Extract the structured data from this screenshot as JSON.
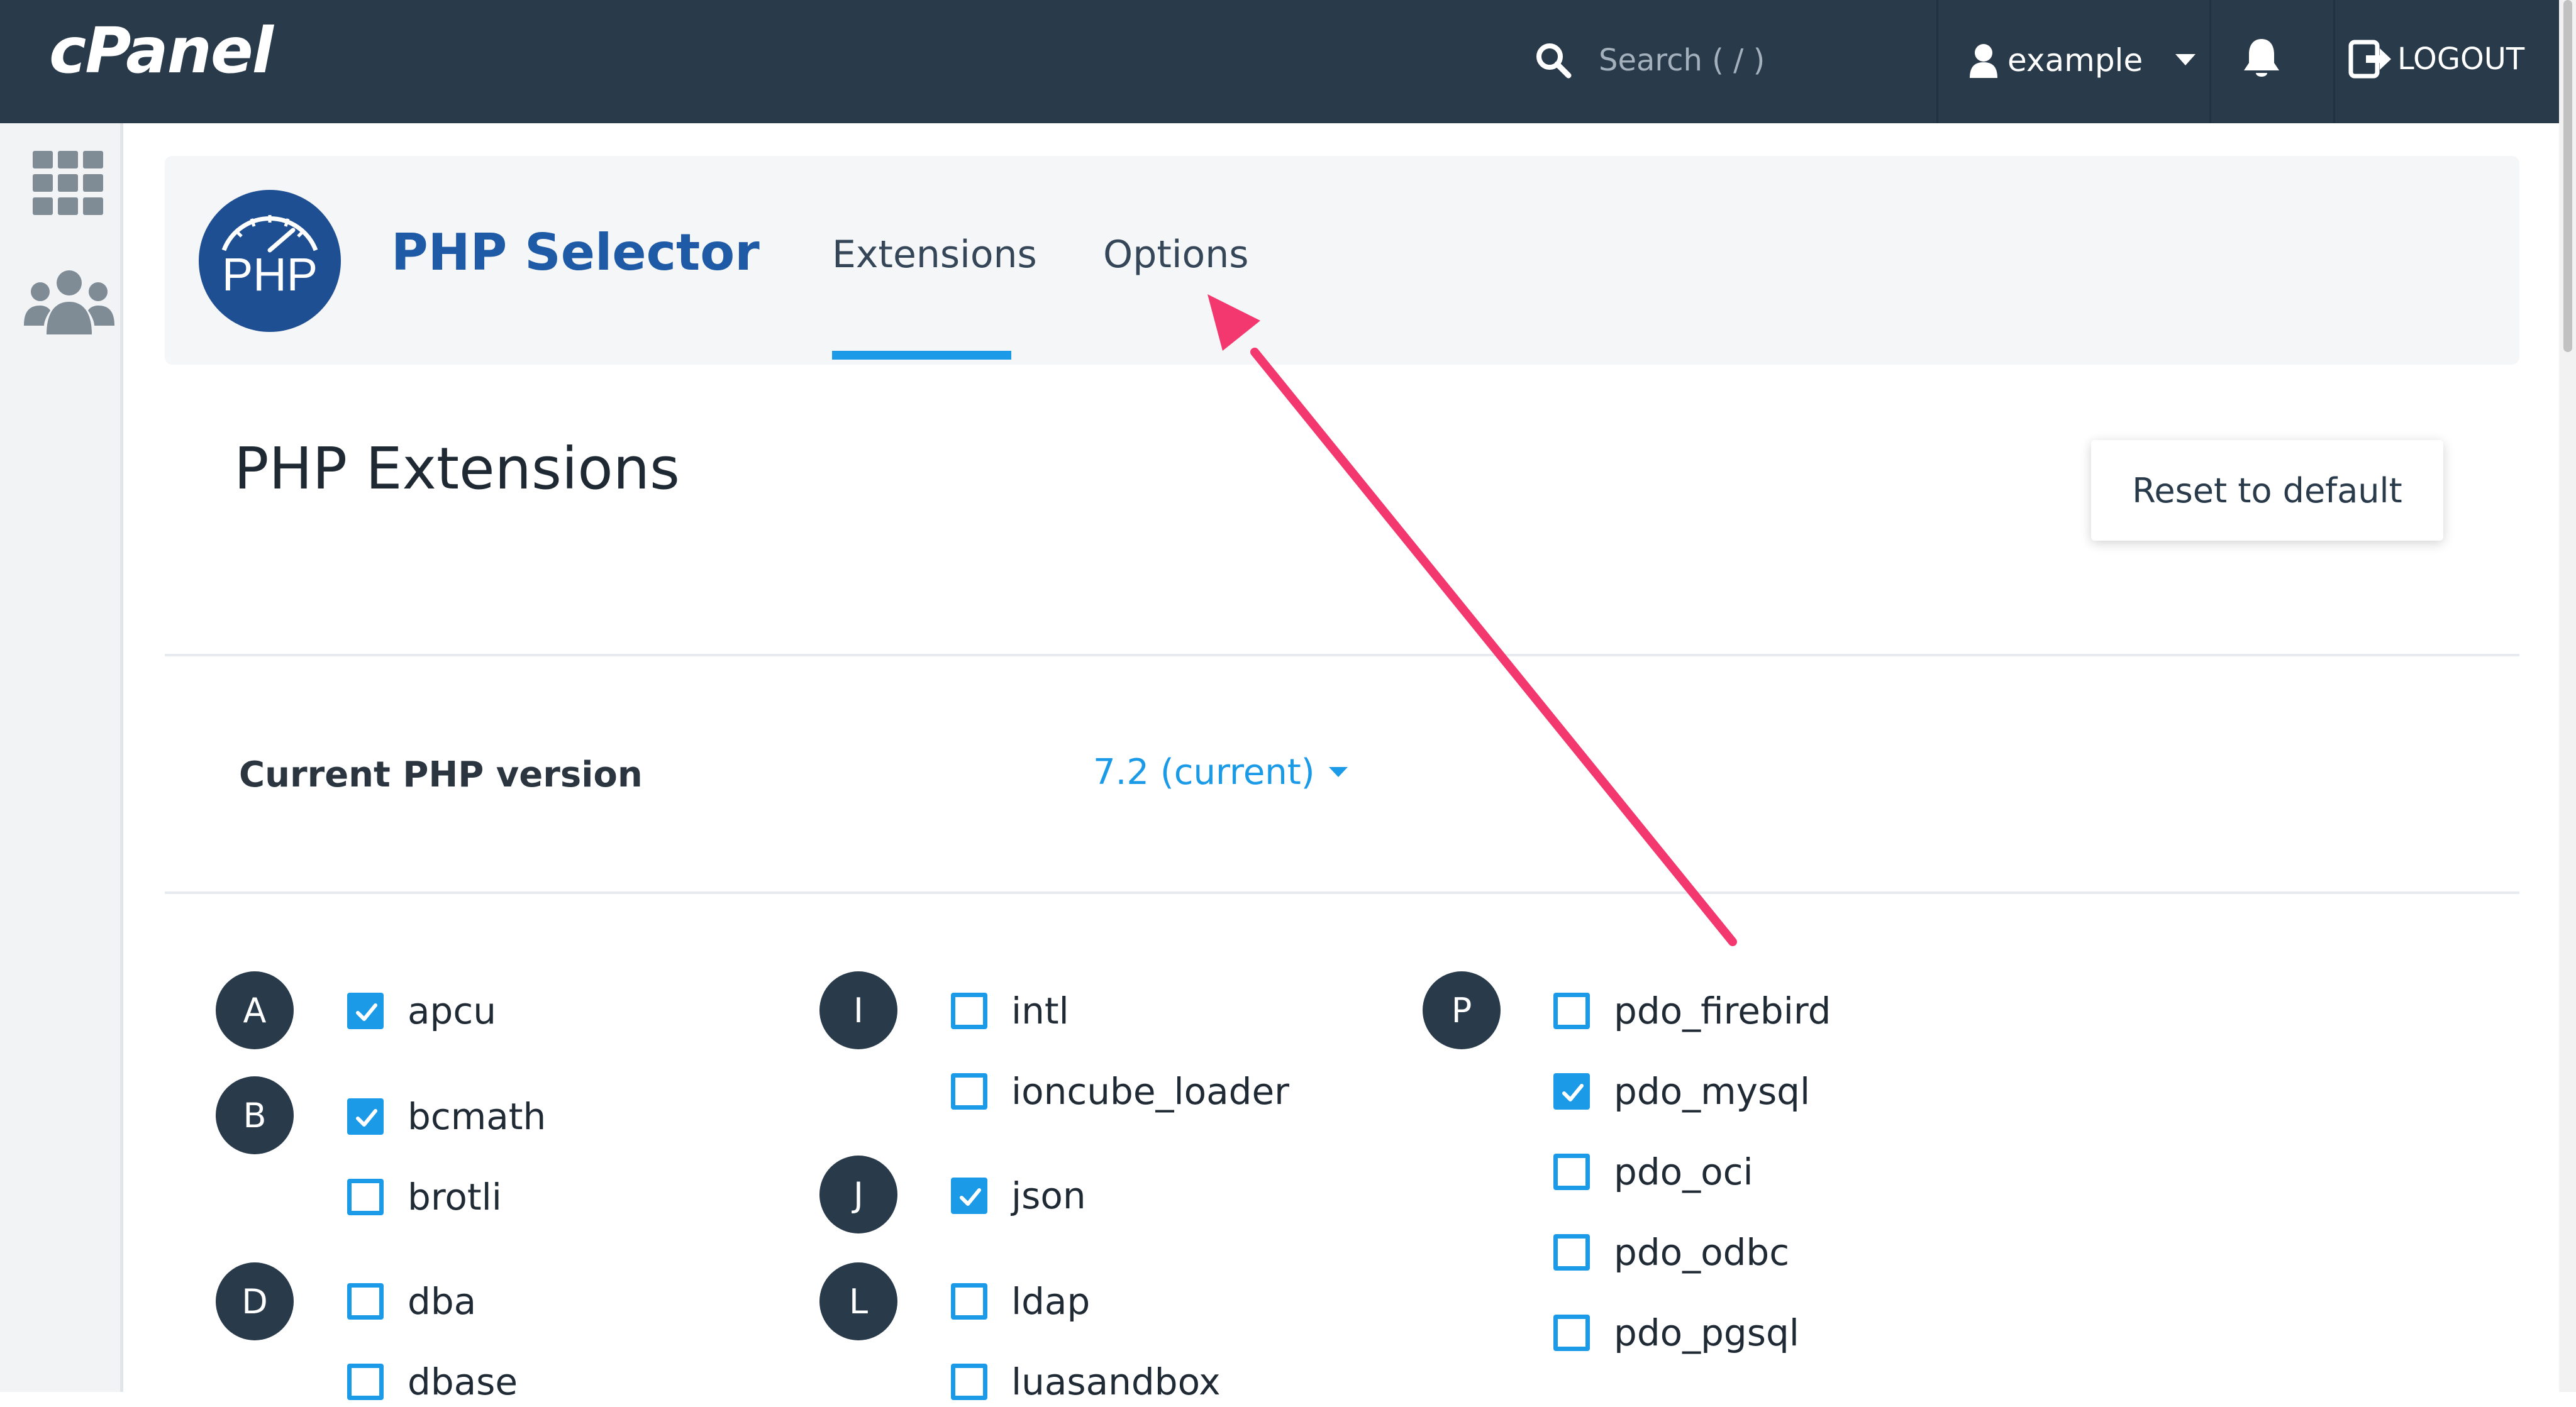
{
  "app": {
    "logo_text": "cPanel"
  },
  "topbar": {
    "search_placeholder": "Search ( / )",
    "username": "example",
    "logout_label": "LOGOUT"
  },
  "sidebar": {
    "icons": [
      "grid-icon",
      "users-icon"
    ]
  },
  "header": {
    "php_logo_text": "PHP",
    "title": "PHP Selector",
    "tabs": [
      {
        "label": "Extensions",
        "active": true
      },
      {
        "label": "Options",
        "active": false
      }
    ]
  },
  "main": {
    "section_title": "PHP Extensions",
    "reset_label": "Reset to default",
    "version_label": "Current PHP version",
    "version_value": "7.2 (current)"
  },
  "letters": [
    "A",
    "B",
    "D",
    "I",
    "J",
    "L",
    "P"
  ],
  "extensions": [
    {
      "name": "apcu",
      "checked": true
    },
    {
      "name": "bcmath",
      "checked": true
    },
    {
      "name": "brotli",
      "checked": false
    },
    {
      "name": "dba",
      "checked": false
    },
    {
      "name": "dbase",
      "checked": false
    },
    {
      "name": "intl",
      "checked": false
    },
    {
      "name": "ioncube_loader",
      "checked": false
    },
    {
      "name": "json",
      "checked": true
    },
    {
      "name": "ldap",
      "checked": false
    },
    {
      "name": "luasandbox",
      "checked": false
    },
    {
      "name": "pdo_firebird",
      "checked": false
    },
    {
      "name": "pdo_mysql",
      "checked": true
    },
    {
      "name": "pdo_oci",
      "checked": false
    },
    {
      "name": "pdo_odbc",
      "checked": false
    },
    {
      "name": "pdo_pgsql",
      "checked": false
    }
  ],
  "colors": {
    "topbar": "#293a4a",
    "accent": "#1b9ae8",
    "title_blue": "#1f5aa6",
    "annotation_arrow": "#f2386f"
  }
}
